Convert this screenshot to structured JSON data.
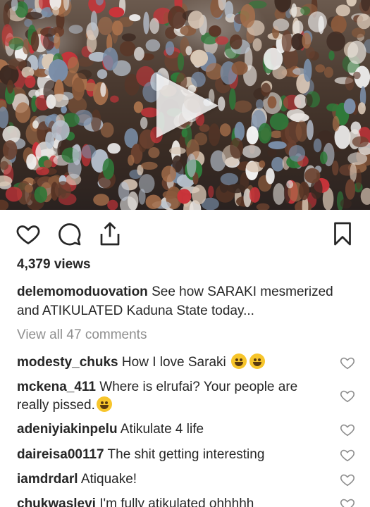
{
  "post": {
    "views": "4,379 views",
    "caption_user": "delemomoduovation",
    "caption_text": " See how SARAKI mesmerized and ATIKULATED Kaduna State today...",
    "view_all": "View all 47 comments"
  },
  "comments": [
    {
      "user": "modesty_chuks",
      "text": " How I love Saraki "
    },
    {
      "user": "mckena_411",
      "text": " Where is elrufai? Your people are really pissed."
    },
    {
      "user": "adeniyiakinpelu",
      "text": " Atikulate 4 life"
    },
    {
      "user": "daireisa00117",
      "text": " The shit getting interesting"
    },
    {
      "user": "iamdrdarl",
      "text": " Atiquake!"
    },
    {
      "user": "chukwaslevi",
      "text": " I'm fully atikulated ohhhhh"
    }
  ],
  "icons": {
    "like": "heart-icon",
    "comment": "comment-icon",
    "share": "share-icon",
    "save": "bookmark-icon",
    "play": "play-icon"
  },
  "colors": {
    "text": "#262626",
    "muted": "#8e8e8e"
  }
}
